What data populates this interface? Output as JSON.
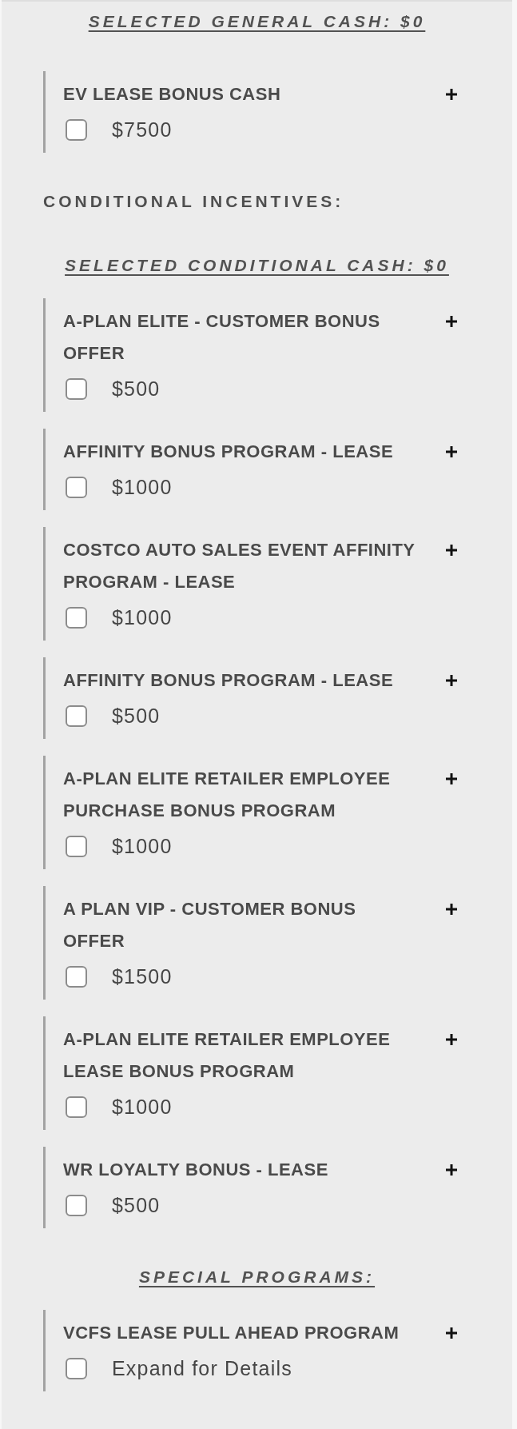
{
  "sections": [
    {
      "summary": "SELECTED GENERAL CASH: $0",
      "items": [
        {
          "title": "EV LEASE BONUS CASH",
          "option": "$7500",
          "checked": false,
          "expanded": false
        }
      ]
    },
    {
      "heading": "CONDITIONAL INCENTIVES:",
      "summary": "SELECTED CONDITIONAL CASH: $0",
      "items": [
        {
          "title": "A-PLAN ELITE - CUSTOMER BONUS OFFER",
          "option": "$500",
          "checked": false,
          "expanded": false
        },
        {
          "title": "AFFINITY BONUS PROGRAM - LEASE",
          "option": "$1000",
          "checked": false,
          "expanded": false
        },
        {
          "title": "COSTCO AUTO SALES EVENT AFFINITY PROGRAM - LEASE",
          "option": "$1000",
          "checked": false,
          "expanded": false
        },
        {
          "title": "AFFINITY BONUS PROGRAM - LEASE",
          "option": "$500",
          "checked": false,
          "expanded": false
        },
        {
          "title": "A-PLAN ELITE RETAILER EMPLOYEE PURCHASE BONUS PROGRAM",
          "option": "$1000",
          "checked": false,
          "expanded": false
        },
        {
          "title": "A PLAN VIP - CUSTOMER BONUS OFFER",
          "option": "$1500",
          "checked": false,
          "expanded": false
        },
        {
          "title": "A-PLAN ELITE RETAILER EMPLOYEE LEASE BONUS PROGRAM",
          "option": "$1000",
          "checked": false,
          "expanded": false
        },
        {
          "title": "WR LOYALTY BONUS - LEASE",
          "option": "$500",
          "checked": false,
          "expanded": false
        }
      ]
    },
    {
      "summary": "SPECIAL PROGRAMS:",
      "items": [
        {
          "title": "VCFS LEASE PULL AHEAD PROGRAM",
          "option": "Expand for Details",
          "checked": false,
          "expanded": false
        }
      ]
    }
  ]
}
